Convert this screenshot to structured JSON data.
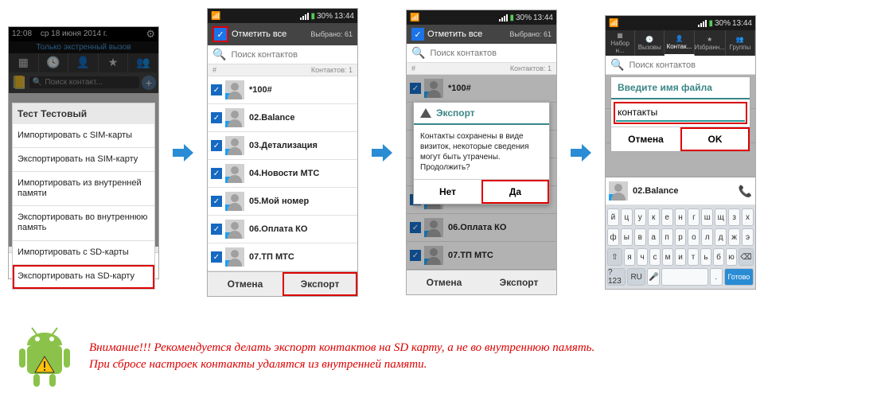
{
  "colors": {
    "highlight": "#d00",
    "accent": "#3b8686"
  },
  "phone1": {
    "status": {
      "time": "12:08",
      "date": "ср 18 июня 2014 г."
    },
    "emergency": "Только экстренный вызов",
    "search_placeholder": "Поиск контакт...",
    "menu_title": "Тест Тестовый",
    "menu_items": [
      "Импортировать с SIM-карты",
      "Экспортировать на SIM-карту",
      "Импортировать из внутренней памяти",
      "Экспортировать во внутреннюю память",
      "Импортировать с SD-карты",
      "Экспортировать на SD-карту"
    ]
  },
  "phone2": {
    "status_time": "13:44",
    "mark_bar_text": "Отметить все",
    "mark_bar_count": "Выбрано: 61",
    "search_placeholder": "Поиск контактов",
    "list_header_left": "#",
    "list_header_right": "Контактов: 1",
    "contacts": [
      "*100#",
      "02.Balance",
      "03.Детализация",
      "04.Новости МТС",
      "05.Мой номер",
      "06.Оплата КО",
      "07.ТП МТС"
    ],
    "btn_cancel": "Отмена",
    "btn_export": "Экспорт"
  },
  "phone3": {
    "status_time": "13:44",
    "mark_bar_text": "Отметить все",
    "mark_bar_count": "Выбрано: 61",
    "search_placeholder": "Поиск контактов",
    "list_header_left": "#",
    "list_header_right": "Контактов: 1",
    "contacts": [
      "*100#",
      "",
      "",
      "",
      "05.Мой номер",
      "06.Оплата КО",
      "07.ТП МТС"
    ],
    "dialog": {
      "title": "Экспорт",
      "body": "Контакты сохранены в виде визиток, некоторые сведения могут быть утрачены. Продолжить?",
      "btn_no": "Нет",
      "btn_yes": "Да"
    },
    "btn_cancel": "Отмена",
    "btn_export": "Экспорт"
  },
  "phone4": {
    "status_time": "13:44",
    "tabs": [
      "Набор н...",
      "Вызовы",
      "Контак...",
      "Избранн...",
      "Группы"
    ],
    "search_placeholder": "Поиск контактов",
    "dialog": {
      "title": "Введите имя файла",
      "value": "контакты",
      "btn_cancel": "Отмена",
      "btn_ok": "OK"
    },
    "visible_contacts": [
      "02.Balance"
    ],
    "keyboard_rows": [
      [
        "й",
        "ц",
        "у",
        "к",
        "е",
        "н",
        "г",
        "ш",
        "щ",
        "з",
        "х"
      ],
      [
        "ф",
        "ы",
        "в",
        "а",
        "п",
        "р",
        "о",
        "л",
        "д",
        "ж",
        "э"
      ],
      [
        "⇧",
        "я",
        "ч",
        "с",
        "м",
        "и",
        "т",
        "ь",
        "б",
        "ю",
        "⌫"
      ]
    ],
    "keyboard_bottom": {
      "sym": "?123",
      "lang": "RU",
      "mic": "🎤",
      "space": " ",
      "dot": ".",
      "enter": "Готово"
    }
  },
  "warning": {
    "line1": "Внимание!!! Рекомендуется делать экспорт контактов на SD карту, а не во внутреннюю память.",
    "line2": "При сбросе настроек контакты удалятся из внутренней памяти."
  }
}
